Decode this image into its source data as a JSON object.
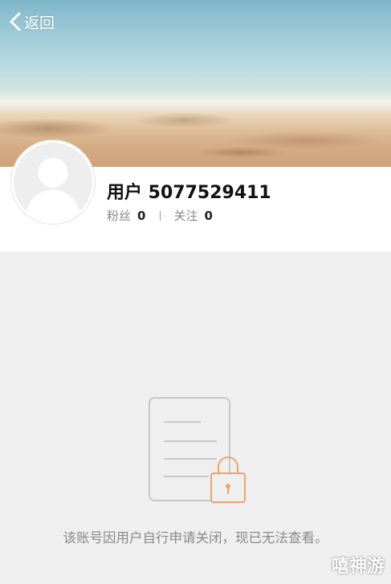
{
  "header": {
    "back_label": "返回",
    "back_icon": "chevron-left-icon"
  },
  "profile": {
    "username": "用户 5077529411",
    "fans_label": "粉丝",
    "fans_count": "0",
    "following_label": "关注",
    "following_count": "0",
    "avatar_icon": "default-avatar-icon"
  },
  "empty_state": {
    "icon": "locked-document-icon",
    "message": "该账号因用户自行申请关闭，现已无法查看。"
  },
  "watermark": {
    "text": "嘻神游"
  },
  "colors": {
    "page_background": "#efefef",
    "icon_gray": "#c8c8c8",
    "lock_orange": "#f0a26a"
  }
}
